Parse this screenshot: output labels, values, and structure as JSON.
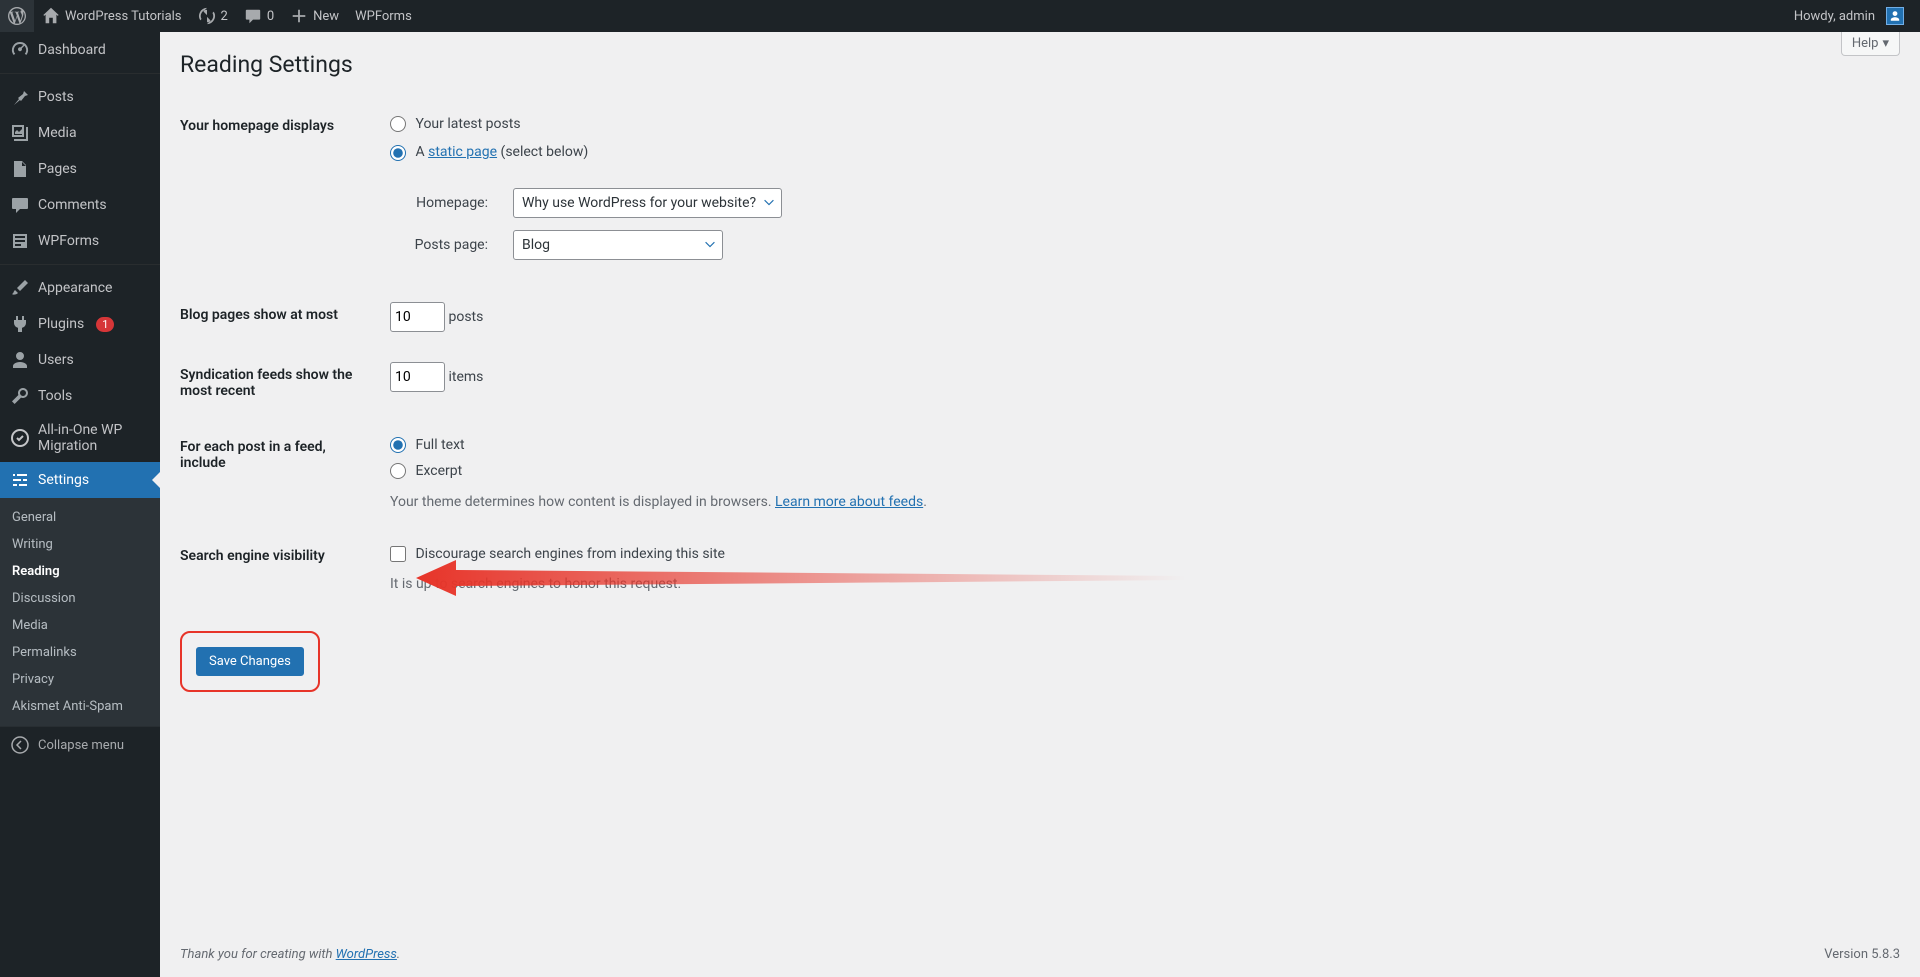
{
  "topbar": {
    "site_title": "WordPress Tutorials",
    "updates_count": "2",
    "comments_count": "0",
    "new_label": "New",
    "wpforms_label": "WPForms",
    "howdy": "Howdy, admin"
  },
  "sidebar": {
    "items": [
      {
        "label": "Dashboard"
      },
      {
        "label": "Posts"
      },
      {
        "label": "Media"
      },
      {
        "label": "Pages"
      },
      {
        "label": "Comments"
      },
      {
        "label": "WPForms"
      },
      {
        "label": "Appearance"
      },
      {
        "label": "Plugins",
        "badge": "1"
      },
      {
        "label": "Users"
      },
      {
        "label": "Tools"
      },
      {
        "label": "All-in-One WP Migration"
      },
      {
        "label": "Settings"
      }
    ],
    "submenu": [
      {
        "label": "General"
      },
      {
        "label": "Writing"
      },
      {
        "label": "Reading"
      },
      {
        "label": "Discussion"
      },
      {
        "label": "Media"
      },
      {
        "label": "Permalinks"
      },
      {
        "label": "Privacy"
      },
      {
        "label": "Akismet Anti-Spam"
      }
    ],
    "collapse": "Collapse menu"
  },
  "page": {
    "help": "Help",
    "title": "Reading Settings",
    "homepage_label": "Your homepage displays",
    "opt_latest": "Your latest posts",
    "opt_static_a": "A ",
    "opt_static_link": "static page",
    "opt_static_suffix": " (select below)",
    "homepage_select_label": "Homepage:",
    "homepage_select_value": "Why use WordPress for your website?",
    "postspage_select_label": "Posts page:",
    "postspage_select_value": "Blog",
    "blogpages_label": "Blog pages show at most",
    "blogpages_value": "10",
    "blogpages_suffix": "posts",
    "syndication_label": "Syndication feeds show the most recent",
    "syndication_value": "10",
    "syndication_suffix": "items",
    "feed_label": "For each post in a feed, include",
    "feed_full": "Full text",
    "feed_excerpt": "Excerpt",
    "feed_desc_prefix": "Your theme determines how content is displayed in browsers. ",
    "feed_desc_link": "Learn more about feeds",
    "search_label": "Search engine visibility",
    "search_checkbox": "Discourage search engines from indexing this site",
    "search_desc": "It is up to search engines to honor this request.",
    "save_button": "Save Changes",
    "footer_prefix": "Thank you for creating with ",
    "footer_link": "WordPress",
    "version": "Version 5.8.3"
  }
}
